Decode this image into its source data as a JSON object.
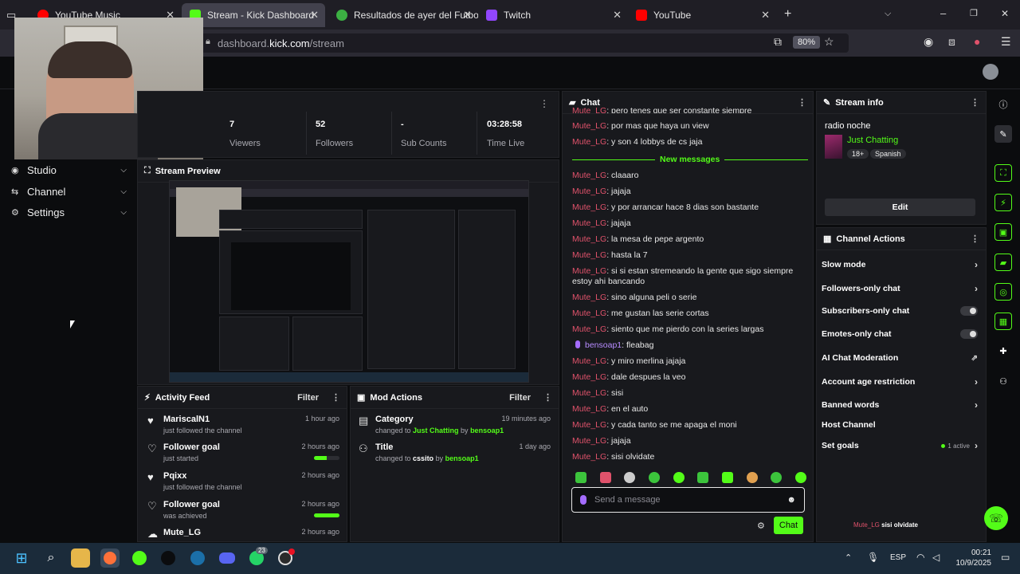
{
  "browser": {
    "tabs": [
      {
        "label": "YouTube Music",
        "color": "#ff0000"
      },
      {
        "label": "Stream - Kick Dashboard",
        "color": "#53fc18"
      },
      {
        "label": "Resultados de ayer del Futbol A",
        "color": "#3cb043"
      },
      {
        "label": "Twitch",
        "color": "#9146ff"
      },
      {
        "label": "YouTube",
        "color": "#ff0000"
      }
    ],
    "url_domain": "dashboard.",
    "url_host": "kick.com",
    "url_path": "/stream",
    "zoom": "80%"
  },
  "sidebar": {
    "items": [
      {
        "label": "Studio"
      },
      {
        "label": "Channel"
      },
      {
        "label": "Settings"
      }
    ]
  },
  "stats": [
    {
      "value": "7",
      "label": "Viewers"
    },
    {
      "value": "52",
      "label": "Followers"
    },
    {
      "value": "-",
      "label": "Sub Counts"
    },
    {
      "value": "03:28:58",
      "label": "Time Live"
    }
  ],
  "preview": {
    "title": "Stream Preview"
  },
  "activity": {
    "title": "Activity Feed",
    "filter": "Filter",
    "items": [
      {
        "name": "MariscalN1",
        "sub": "just followed the channel",
        "time": "1 hour ago"
      },
      {
        "name": "Follower goal",
        "sub": "just started",
        "time": "2 hours ago",
        "progress": 0.5
      },
      {
        "name": "Pqixx",
        "sub": "just followed the channel",
        "time": "2 hours ago"
      },
      {
        "name": "Follower goal",
        "sub": "was achieved",
        "time": "2 hours ago",
        "progress": 1.0
      },
      {
        "name": "Mute_LG",
        "sub": "",
        "time": "2 hours ago"
      }
    ]
  },
  "mod": {
    "title": "Mod Actions",
    "filter": "Filter",
    "items": [
      {
        "name": "Category",
        "pre": "changed to ",
        "target": "Just Chatting",
        "by": " by ",
        "user": "bensoap1",
        "time": "19 minutes ago"
      },
      {
        "name": "Title",
        "pre": "changed to ",
        "target": "cssito",
        "by": " by ",
        "user": "bensoap1",
        "time": "1 day ago"
      }
    ]
  },
  "chat": {
    "title": "Chat",
    "new_messages": "New messages",
    "top": [
      {
        "user": "Mute_LG",
        "text": ": pero tenes que ser constante siempre"
      },
      {
        "user": "Mute_LG",
        "text": ": por mas que haya un view"
      },
      {
        "user": "Mute_LG",
        "text": ": y son 4 lobbys de cs jaja"
      }
    ],
    "messages": [
      {
        "user": "Mute_LG",
        "text": ": claaaro"
      },
      {
        "user": "Mute_LG",
        "text": ": jajaja"
      },
      {
        "user": "Mute_LG",
        "text": ": y por arrancar hace 8 dias son bastante"
      },
      {
        "user": "Mute_LG",
        "text": ": jajaja"
      },
      {
        "user": "Mute_LG",
        "text": ": la mesa de pepe argento"
      },
      {
        "user": "Mute_LG",
        "text": ": hasta la 7"
      },
      {
        "user": "Mute_LG",
        "text": ": si si estan stremeando la gente que sigo siempre estoy ahi bancando"
      },
      {
        "user": "Mute_LG",
        "text": ": sino alguna peli o serie"
      },
      {
        "user": "Mute_LG",
        "text": ": me gustan las serie cortas"
      },
      {
        "user": "Mute_LG",
        "text": ": siento que me pierdo con la series largas"
      },
      {
        "user": "bensoap1",
        "text": ": fleabag"
      },
      {
        "user": "Mute_LG",
        "text": ": y miro merlina jajaja"
      },
      {
        "user": "Mute_LG",
        "text": ": dale despues la veo"
      },
      {
        "user": "Mute_LG",
        "text": ": sisi"
      },
      {
        "user": "Mute_LG",
        "text": ": en el auto"
      },
      {
        "user": "Mute_LG",
        "text": ": y cada tanto se me apaga el moni"
      },
      {
        "user": "Mute_LG",
        "text": ": jajaja"
      },
      {
        "user": "Mute_LG",
        "text": ": sisi olvidate"
      }
    ],
    "placeholder": "Send a message",
    "send": "Chat"
  },
  "stream_info": {
    "title": "Stream info",
    "stream_title": "radio noche",
    "category": "Just Chatting",
    "tags": [
      "18+",
      "Spanish"
    ],
    "edit": "Edit"
  },
  "channel_actions": {
    "title": "Channel Actions",
    "items": [
      {
        "label": "Slow mode",
        "kind": "chevron"
      },
      {
        "label": "Followers-only chat",
        "kind": "chevron"
      },
      {
        "label": "Subscribers-only chat",
        "kind": "toggle"
      },
      {
        "label": "Emotes-only chat",
        "kind": "toggle"
      },
      {
        "label": "AI Chat Moderation",
        "kind": "external"
      },
      {
        "label": "Account age restriction",
        "kind": "chevron"
      },
      {
        "label": "Banned words",
        "kind": "chevron"
      },
      {
        "label": "Host Channel",
        "kind": "none"
      },
      {
        "label": "Set goals",
        "kind": "chevron",
        "badge": "1 active"
      }
    ]
  },
  "overlay_chat": {
    "user": "Mute_LG",
    "text": " sisi olvidate"
  },
  "taskbar": {
    "lang": "ESP",
    "time": "00:21",
    "date": "10/9/2025",
    "whatsapp_badge": "23"
  },
  "colors": {
    "accent": "#53fc18",
    "username": "#e0526b"
  }
}
